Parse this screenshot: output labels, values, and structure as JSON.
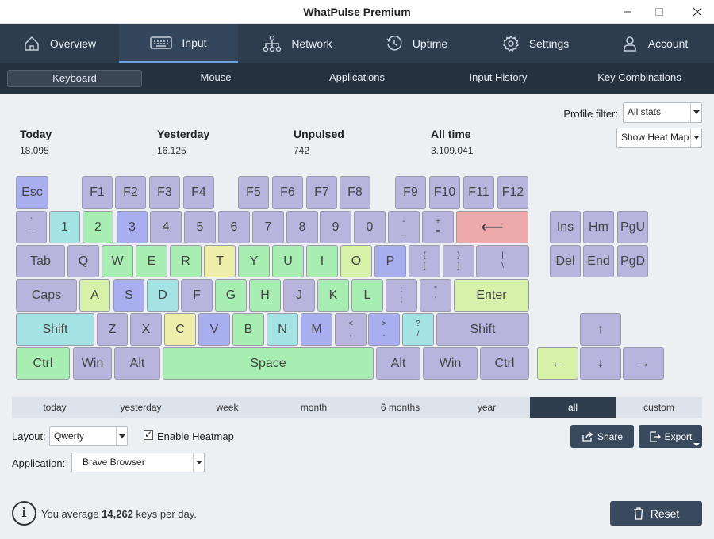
{
  "window": {
    "title": "WhatPulse Premium"
  },
  "main_tabs": [
    {
      "label": "Overview",
      "icon": "home-icon"
    },
    {
      "label": "Input",
      "icon": "keyboard-icon"
    },
    {
      "label": "Network",
      "icon": "network-icon"
    },
    {
      "label": "Uptime",
      "icon": "clock-icon"
    },
    {
      "label": "Settings",
      "icon": "gear-icon"
    },
    {
      "label": "Account",
      "icon": "user-icon"
    }
  ],
  "sub_tabs": [
    "Keyboard",
    "Mouse",
    "Applications",
    "Input History",
    "Key Combinations"
  ],
  "stats": [
    {
      "label": "Today",
      "value": "18.095"
    },
    {
      "label": "Yesterday",
      "value": "16.125"
    },
    {
      "label": "Unpulsed",
      "value": "742"
    },
    {
      "label": "All time",
      "value": "3.109.041"
    }
  ],
  "profile_filter": {
    "label": "Profile filter:",
    "value": "All stats"
  },
  "heatmap_select": {
    "value": "Show Heat Map"
  },
  "heat_colors": {
    "low": "#b9b4de",
    "lowmid": "#a8aef0",
    "mid": "#a3e3e3",
    "midhigh": "#a8eeb3",
    "high": "#d8f1a8",
    "yellow": "#eeeeaa",
    "top": "#eeaaaa"
  },
  "keys": {
    "esc": "Esc",
    "f1": "F1",
    "f2": "F2",
    "f3": "F3",
    "f4": "F4",
    "f5": "F5",
    "f6": "F6",
    "f7": "F7",
    "f8": "F8",
    "f9": "F9",
    "f10": "F10",
    "f11": "F11",
    "f12": "F12",
    "backtick_top": "`",
    "backtick_bottom": "~",
    "n1": "1",
    "n2": "2",
    "n3": "3",
    "n4": "4",
    "n5": "5",
    "n6": "6",
    "n7": "7",
    "n8": "8",
    "n9": "9",
    "n0": "0",
    "minus_top": "-",
    "minus_bottom": "_",
    "equals_top": "+",
    "equals_bottom": "=",
    "backspace": "⟵",
    "ins": "Ins",
    "home": "Hm",
    "pgup": "PgU",
    "del": "Del",
    "end": "End",
    "pgdn": "PgD",
    "tab": "Tab",
    "q": "Q",
    "w": "W",
    "e": "E",
    "r": "R",
    "t": "T",
    "y": "Y",
    "u": "U",
    "i": "I",
    "o": "O",
    "p": "P",
    "lbracket_top": "{",
    "lbracket_bottom": "[",
    "rbracket_top": "}",
    "rbracket_bottom": "]",
    "backslash_top": "|",
    "backslash_bottom": "\\",
    "caps": "Caps",
    "a": "A",
    "s": "S",
    "d": "D",
    "f": "F",
    "g": "G",
    "h": "H",
    "j": "J",
    "k": "K",
    "l": "L",
    "semicolon_top": ":",
    "semicolon_bottom": ";",
    "quote_top": "\"",
    "quote_bottom": "'",
    "enter": "Enter",
    "lshift": "Shift",
    "z": "Z",
    "x": "X",
    "c": "C",
    "v": "V",
    "b": "B",
    "n": "N",
    "m": "M",
    "comma_top": "<",
    "comma_bottom": ",",
    "period_top": ">",
    "period_bottom": ".",
    "slash_top": "?",
    "slash_bottom": "/",
    "rshift": "Shift",
    "lctrl": "Ctrl",
    "lwin": "Win",
    "lalt": "Alt",
    "space": "Space",
    "ralt": "Alt",
    "rwin": "Win",
    "rctrl": "Ctrl",
    "up": "↑",
    "left": "←",
    "down": "↓",
    "right": "→"
  },
  "periods": [
    "today",
    "yesterday",
    "week",
    "month",
    "6 months",
    "year",
    "all",
    "custom"
  ],
  "active_period": "all",
  "layout": {
    "label": "Layout:",
    "value": "Qwerty"
  },
  "enable_heatmap": {
    "label": "Enable Heatmap",
    "checked": true
  },
  "application": {
    "label": "Application:",
    "value": "Brave Browser"
  },
  "buttons": {
    "share": "Share",
    "export": "Export",
    "reset": "Reset"
  },
  "footer": {
    "prefix": "You average ",
    "count": "14,262",
    "suffix": " keys per day."
  }
}
